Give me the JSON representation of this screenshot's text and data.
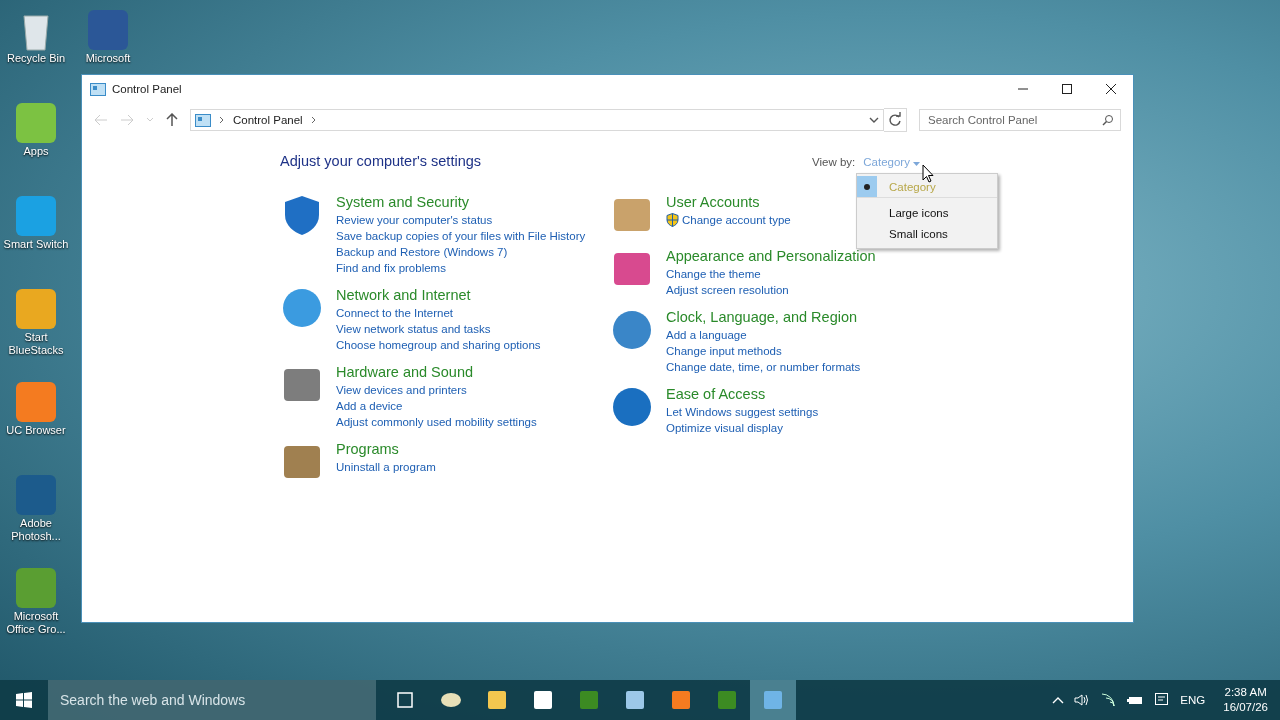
{
  "desktop_columns": [
    [
      {
        "label": "Recycle Bin",
        "kind": "bin"
      },
      {
        "label": "Apps",
        "kind": "apps"
      },
      {
        "label": "Smart Switch",
        "kind": "switch"
      },
      {
        "label": "Start BlueStacks",
        "kind": "stacks"
      },
      {
        "label": "UC Browser",
        "kind": "uc"
      },
      {
        "label": "Adobe Photosh...",
        "kind": "ps"
      },
      {
        "label": "Microsoft Office Gro...",
        "kind": "groove"
      }
    ],
    [
      {
        "label": "Microsoft",
        "kind": "word"
      }
    ]
  ],
  "window": {
    "title": "Control Panel",
    "address": {
      "crumbs": [
        "Control Panel"
      ]
    },
    "search": {
      "placeholder": "Search Control Panel"
    },
    "heading": "Adjust your computer's settings",
    "view_by": {
      "label": "View by:",
      "value": "Category",
      "options": [
        {
          "label": "Category",
          "selected": true
        },
        {
          "label": "Large icons",
          "selected": false
        },
        {
          "label": "Small icons",
          "selected": false
        }
      ]
    },
    "columns": [
      [
        {
          "title": "System and Security",
          "kind": "security",
          "links": [
            {
              "text": "Review your computer's status"
            },
            {
              "text": "Save backup copies of your files with File History"
            },
            {
              "text": "Backup and Restore (Windows 7)"
            },
            {
              "text": "Find and fix problems"
            }
          ]
        },
        {
          "title": "Network and Internet",
          "kind": "network",
          "links": [
            {
              "text": "Connect to the Internet"
            },
            {
              "text": "View network status and tasks"
            },
            {
              "text": "Choose homegroup and sharing options"
            }
          ]
        },
        {
          "title": "Hardware and Sound",
          "kind": "hardware",
          "links": [
            {
              "text": "View devices and printers"
            },
            {
              "text": "Add a device"
            },
            {
              "text": "Adjust commonly used mobility settings"
            }
          ]
        },
        {
          "title": "Programs",
          "kind": "programs",
          "links": [
            {
              "text": "Uninstall a program"
            }
          ]
        }
      ],
      [
        {
          "title": "User Accounts",
          "kind": "users",
          "links": [
            {
              "text": "Change account type",
              "shield": true
            }
          ]
        },
        {
          "title": "Appearance and Personalization",
          "kind": "appearance",
          "links": [
            {
              "text": "Change the theme"
            },
            {
              "text": "Adjust screen resolution"
            }
          ]
        },
        {
          "title": "Clock, Language, and Region",
          "kind": "clock",
          "links": [
            {
              "text": "Add a language"
            },
            {
              "text": "Change input methods"
            },
            {
              "text": "Change date, time, or number formats"
            }
          ]
        },
        {
          "title": "Ease of Access",
          "kind": "ease",
          "links": [
            {
              "text": "Let Windows suggest settings"
            },
            {
              "text": "Optimize visual display"
            }
          ]
        }
      ]
    ]
  },
  "taskbar": {
    "search": {
      "placeholder": "Search the web and Windows"
    },
    "apps": [
      {
        "kind": "taskview",
        "selected": false
      },
      {
        "kind": "audio",
        "selected": false
      },
      {
        "kind": "folder",
        "selected": false
      },
      {
        "kind": "store",
        "selected": false
      },
      {
        "kind": "camtasia",
        "selected": false
      },
      {
        "kind": "notes",
        "selected": false
      },
      {
        "kind": "uc",
        "selected": false
      },
      {
        "kind": "camtasia",
        "selected": false
      },
      {
        "kind": "panel",
        "selected": true
      }
    ],
    "language": "ENG",
    "time": "2:38 AM",
    "date": "16/07/26"
  }
}
